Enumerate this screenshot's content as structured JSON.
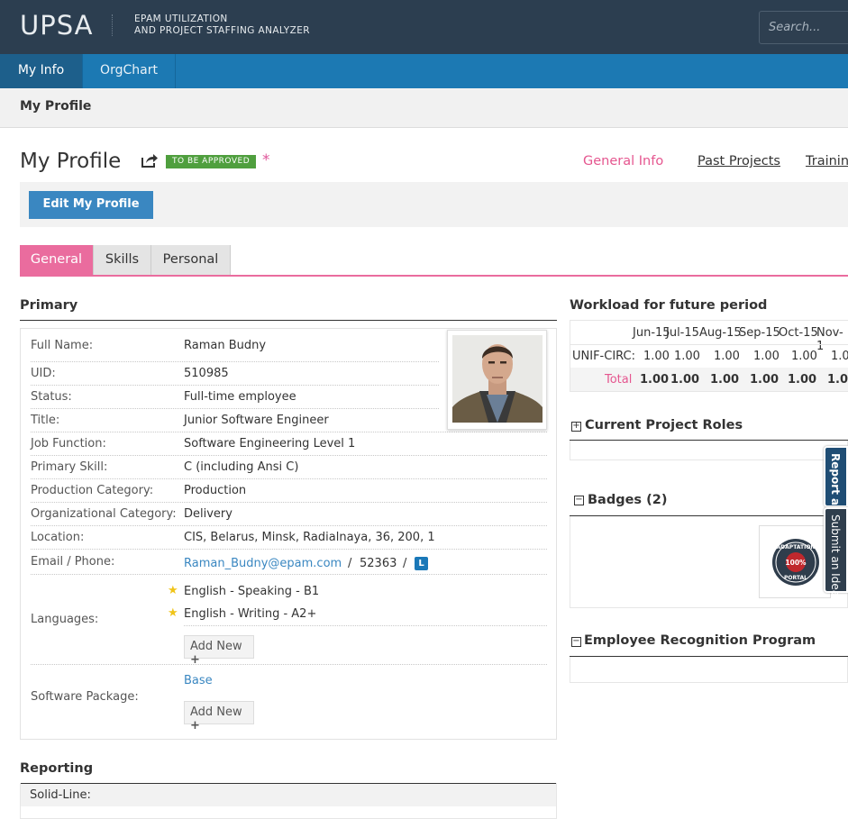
{
  "header": {
    "logo": "UPSA",
    "tagline_line1": "EPAM UTILIZATION",
    "tagline_line2": "AND PROJECT STAFFING ANALYZER",
    "search_placeholder": "Search..."
  },
  "nav": {
    "tabs": [
      {
        "label": "My Info",
        "active": true
      },
      {
        "label": "OrgChart",
        "active": false
      }
    ]
  },
  "breadcrumb": "My Profile",
  "profile": {
    "title": "My Profile",
    "status_badge": "TO BE APPROVED",
    "required_mark": "*",
    "top_links": [
      "General Info",
      "Past Projects",
      "Training"
    ],
    "edit_button": "Edit My Profile",
    "tabs": [
      "General",
      "Skills",
      "Personal"
    ]
  },
  "primary": {
    "heading": "Primary",
    "fields": [
      {
        "label": "Full Name:",
        "value": "Raman Budny"
      },
      {
        "label": "UID:",
        "value": "510985"
      },
      {
        "label": "Status:",
        "value": "Full-time employee"
      },
      {
        "label": "Title:",
        "value": "Junior Software Engineer"
      },
      {
        "label": "Job Function:",
        "value": "Software Engineering Level 1"
      },
      {
        "label": "Primary Skill:",
        "value": "C (including Ansi C)"
      },
      {
        "label": "Production Category:",
        "value": "Production"
      },
      {
        "label": "Organizational Category:",
        "value": "Delivery"
      },
      {
        "label": "Location:",
        "value": "CIS, Belarus, Minsk, Radialnaya, 36, 200, 1"
      }
    ],
    "email_label": "Email / Phone:",
    "email": "Raman_Budny@epam.com",
    "phone_sep1": "/",
    "phone": "52363",
    "phone_sep2": "/",
    "linkedin_glyph": "L",
    "languages_label": "Languages:",
    "languages": [
      "English - Speaking - B1",
      "English - Writing - A2+"
    ],
    "add_new": "Add New",
    "software_label": "Software Package:",
    "software_value": "Base"
  },
  "reporting": {
    "heading": "Reporting",
    "solid_line_label": "Solid-Line:"
  },
  "workload": {
    "heading": "Workload for future period",
    "months": [
      "Jun-15",
      "Jul-15",
      "Aug-15",
      "Sep-15",
      "Oct-15",
      "Nov-1"
    ],
    "rows": [
      {
        "label": "UNIF-CIRC:",
        "values": [
          "1.00",
          "1.00",
          "1.00",
          "1.00",
          "1.00",
          "1.0"
        ]
      },
      {
        "label": "Total",
        "values": [
          "1.00",
          "1.00",
          "1.00",
          "1.00",
          "1.00",
          "1.0"
        ]
      }
    ]
  },
  "sections": {
    "current_roles": "Current Project Roles",
    "badges": "Badges (2)",
    "erp": "Employee Recognition Program"
  },
  "award_badge": {
    "top_text": "ADAPTATION",
    "center_text": "100%",
    "bottom_text": "PORTAL"
  },
  "side_tabs": [
    "Report a B",
    "Submit an Idea"
  ],
  "colors": {
    "header": "#2c3e50",
    "nav": "#1c79b3",
    "accent_pink": "#ea6c9e",
    "approve_green": "#4f9f3e",
    "button_blue": "#3a87c1"
  }
}
